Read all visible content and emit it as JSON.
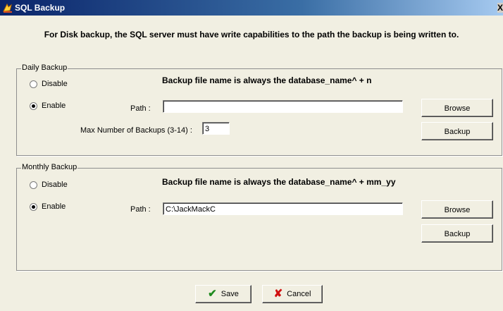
{
  "window": {
    "title": "SQL Backup",
    "close_glyph": "X"
  },
  "header_note": "For Disk backup, the SQL server must have write capabilities to the path the backup is being written to.",
  "daily": {
    "legend": "Daily Backup",
    "disable_label": "Disable",
    "enable_label": "Enable",
    "selected": "Enable",
    "note": "Backup file name is always the database_name^ + n",
    "path_label": "Path :",
    "path_value": "",
    "max_label": "Max Number of Backups (3-14) :",
    "max_value": "3",
    "browse_label": "Browse",
    "backup_label": "Backup"
  },
  "monthly": {
    "legend": "Monthly Backup",
    "disable_label": "Disable",
    "enable_label": "Enable",
    "selected": "Enable",
    "note": "Backup file name is always the database_name^ + mm_yy",
    "path_label": "Path :",
    "path_value": "C:\\JackMackC",
    "browse_label": "Browse",
    "backup_label": "Backup"
  },
  "footer": {
    "save_label": "Save",
    "cancel_label": "Cancel",
    "save_icon": "check-icon",
    "cancel_icon": "x-icon"
  }
}
